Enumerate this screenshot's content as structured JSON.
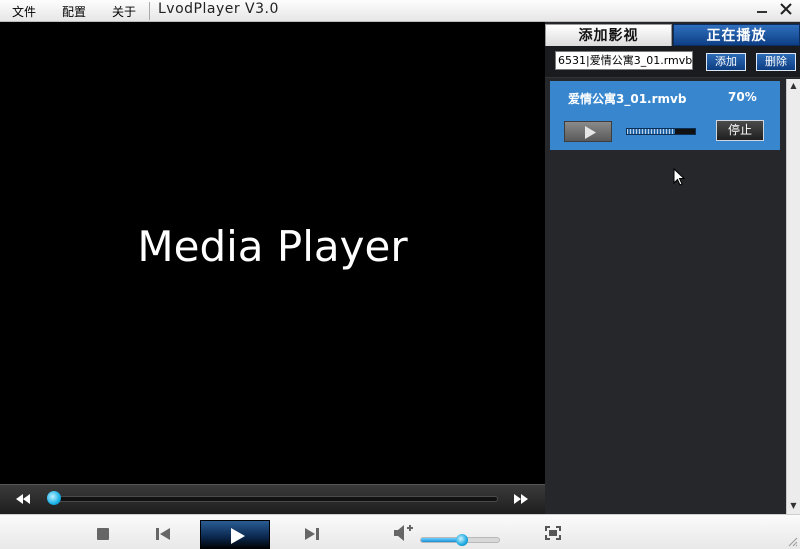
{
  "menu": {
    "items": [
      {
        "label": "文件"
      },
      {
        "label": "配置"
      },
      {
        "label": "关于"
      }
    ]
  },
  "window": {
    "title": "LvodPlayer V3.0",
    "minimize_icon": "minimize-icon",
    "close_icon": "close-icon"
  },
  "video": {
    "logo_text": "Media Player"
  },
  "seek": {
    "progress": 0.01
  },
  "panel": {
    "tab_add": "添加影视",
    "tab_playing": "正在播放",
    "url_value": "6531|爱情公寓3_01.rmvb|",
    "add_button": "添加",
    "delete_button": "删除",
    "tasks": [
      {
        "name": "爱情公寓3_01.rmvb",
        "percent": "70%",
        "progress": 0.7,
        "stop_label": "停止"
      }
    ]
  },
  "controls": {
    "volume": 0.52
  },
  "colors": {
    "accent_blue": "#3886cd",
    "tab_blue": "#0e3f86",
    "seek_thumb": "#18b1e8",
    "panel_bg": "#25272b"
  }
}
